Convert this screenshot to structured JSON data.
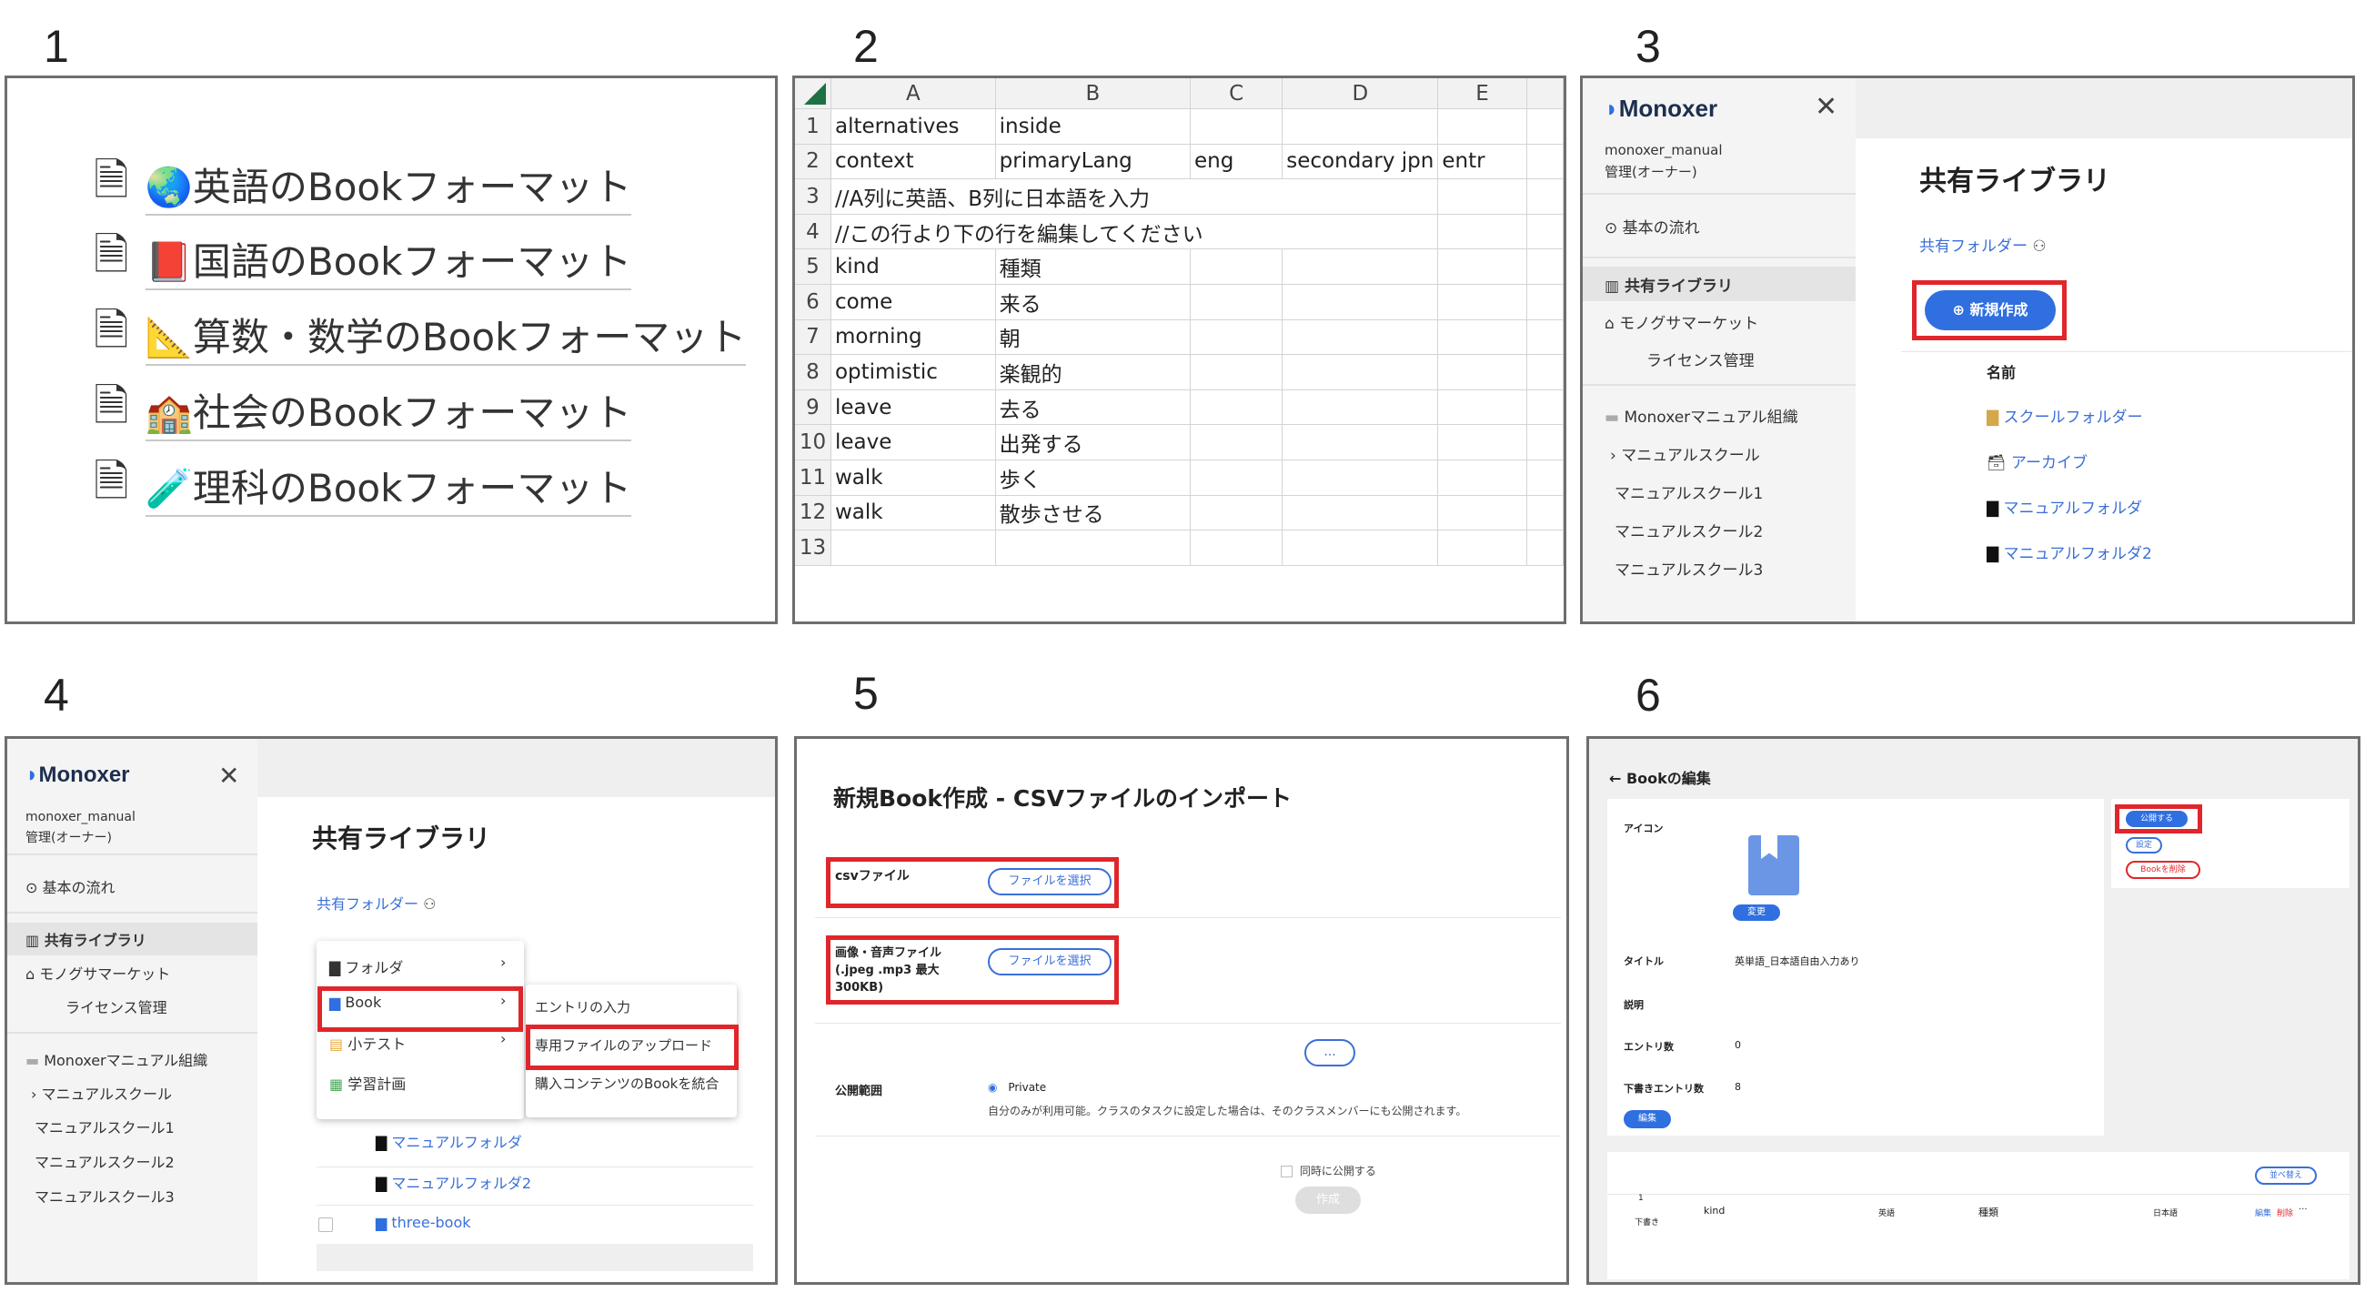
{
  "step_numbers": [
    "1",
    "2",
    "3",
    "4",
    "5",
    "6"
  ],
  "panel1": {
    "items": [
      {
        "icon": "globe-emoji",
        "label": "英語のBookフォーマット"
      },
      {
        "icon": "red-book-emoji",
        "label": "国語のBookフォーマット"
      },
      {
        "icon": "triangle-ruler-emoji",
        "label": "算数・数学のBookフォーマット"
      },
      {
        "icon": "school-emoji",
        "label": "社会のBookフォーマット"
      },
      {
        "icon": "test-tube-emoji",
        "label": "理科のBookフォーマット"
      }
    ]
  },
  "panel2": {
    "columns": [
      "A",
      "B",
      "C",
      "D",
      "E"
    ],
    "rows": [
      {
        "n": "1",
        "a": "alternatives",
        "b": "inside",
        "c": "",
        "d": "",
        "e": ""
      },
      {
        "n": "2",
        "a": "context",
        "b": "primaryLang",
        "c": "eng",
        "d": "secondary jpn",
        "e": "entr"
      },
      {
        "n": "3",
        "a": "//A列に英語、B列に日本語を入力",
        "b": "",
        "c": "",
        "d": "",
        "e": ""
      },
      {
        "n": "4",
        "a": "//この行より下の行を編集してください",
        "b": "",
        "c": "",
        "d": "",
        "e": ""
      },
      {
        "n": "5",
        "a": "kind",
        "b": "種類",
        "c": "",
        "d": "",
        "e": ""
      },
      {
        "n": "6",
        "a": "come",
        "b": "来る",
        "c": "",
        "d": "",
        "e": ""
      },
      {
        "n": "7",
        "a": "morning",
        "b": "朝",
        "c": "",
        "d": "",
        "e": ""
      },
      {
        "n": "8",
        "a": "optimistic",
        "b": "楽観的",
        "c": "",
        "d": "",
        "e": ""
      },
      {
        "n": "9",
        "a": "leave",
        "b": "去る",
        "c": "",
        "d": "",
        "e": ""
      },
      {
        "n": "10",
        "a": "leave",
        "b": "出発する",
        "c": "",
        "d": "",
        "e": ""
      },
      {
        "n": "11",
        "a": "walk",
        "b": "歩く",
        "c": "",
        "d": "",
        "e": ""
      },
      {
        "n": "12",
        "a": "walk",
        "b": "散歩させる",
        "c": "",
        "d": "",
        "e": ""
      },
      {
        "n": "13",
        "a": "",
        "b": "",
        "c": "",
        "d": "",
        "e": ""
      }
    ]
  },
  "panel3": {
    "logo": "Monoxer",
    "user": "monoxer_manual",
    "role": "管理(オーナー)",
    "nav": {
      "basic_flow": "基本の流れ",
      "shared_library": "共有ライブラリ",
      "monogo_market": "モノグサマーケット",
      "license": "ライセンス管理",
      "org": "Monoxerマニュアル組織",
      "school": "マニュアルスクール",
      "school1": "マニュアルスクール1",
      "school2": "マニュアルスクール2",
      "school3": "マニュアルスクール3"
    },
    "title": "共有ライブラリ",
    "breadcrumb": "共有フォルダー",
    "new_button": "新規作成",
    "col_name": "名前",
    "items": [
      "スクールフォルダー",
      "アーカイブ",
      "マニュアルフォルダ",
      "マニュアルフォルダ2"
    ]
  },
  "panel4": {
    "logo": "Monoxer",
    "user": "monoxer_manual",
    "role": "管理(オーナー)",
    "nav": {
      "basic_flow": "基本の流れ",
      "shared_library": "共有ライブラリ",
      "monogo_market": "モノグサマーケット",
      "license": "ライセンス管理",
      "org": "Monoxerマニュアル組織",
      "school": "マニュアルスクール",
      "school1": "マニュアルスクール1",
      "school2": "マニュアルスクール2",
      "school3": "マニュアルスクール3"
    },
    "title": "共有ライブラリ",
    "breadcrumb": "共有フォルダー",
    "menu": [
      "フォルダ",
      "Book",
      "小テスト",
      "学習計画"
    ],
    "submenu": [
      "エントリの入力",
      "専用ファイルのアップロード",
      "購入コンテンツのBookを統合"
    ],
    "items": [
      "マニュアルフォルダ",
      "マニュアルフォルダ2",
      "three-book"
    ]
  },
  "panel5": {
    "title": "新規Book作成 - CSVファイルのインポート",
    "csv_label": "csvファイル",
    "csv_button": "ファイルを選択",
    "media_label_1": "画像・音声ファイル",
    "media_label_2": "(.jpeg .mp3 最大",
    "media_label_3": "300KB)",
    "media_button": "ファイルを選択",
    "more_button": "...",
    "scope_label": "公開範囲",
    "scope_option": "Private",
    "scope_note": "自分のみが利用可能。クラスのタスクに設定した場合は、そのクラスメンバーにも公開されます。",
    "publish_check": "同時に公開する",
    "create_button": "作成"
  },
  "panel6": {
    "back_title": "Bookの編集",
    "icon_label": "アイコン",
    "change_button": "変更",
    "title_label": "タイトル",
    "title_value": "英単語_日本語自由入力あり",
    "desc_label": "説明",
    "entries_label": "エントリ数",
    "entries_value": "0",
    "draft_label": "下書きエントリ数",
    "draft_value": "8",
    "edit_button": "編集",
    "publish_button": "公開する",
    "settings_button": "設定",
    "delete_button": "Bookを削除",
    "sort_button": "並べ替え",
    "row_num": "1",
    "row_status": "下書き",
    "row_a": "kind",
    "row_a_lang": "英語",
    "row_b": "種類",
    "row_b_lang": "日本語",
    "row_edit": "編集",
    "row_delete": "削除",
    "row_more": "···"
  },
  "colors": {
    "accent_red": "#e0262b",
    "link_blue": "#3a6fd8",
    "button_blue": "#2f6fe0",
    "excel_green": "#1e7145"
  }
}
